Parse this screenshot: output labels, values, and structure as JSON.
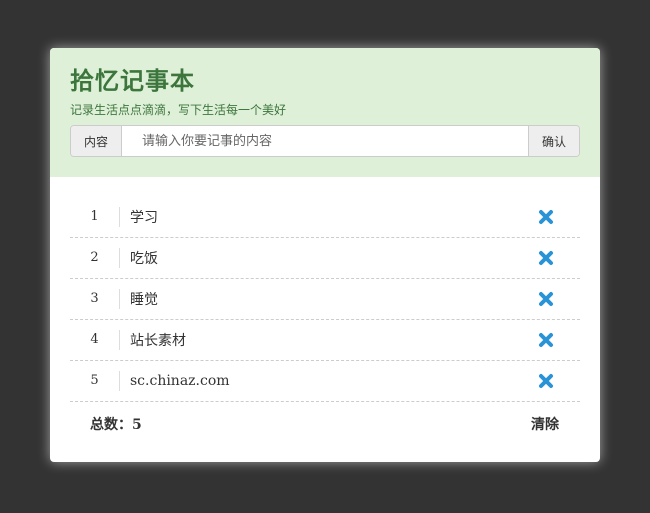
{
  "header": {
    "title": "拾忆记事本",
    "subtitle": "记录生活点点滴滴，写下生活每一个美好"
  },
  "input": {
    "addon_label": "内容",
    "placeholder": "请输入你要记事的内容",
    "value": "",
    "confirm_label": "确认"
  },
  "items": [
    {
      "num": "1",
      "text": "学习"
    },
    {
      "num": "2",
      "text": "吃饭"
    },
    {
      "num": "3",
      "text": "睡觉"
    },
    {
      "num": "4",
      "text": "站长素材"
    },
    {
      "num": "5",
      "text": "sc.chinaz.com"
    }
  ],
  "footer": {
    "total_label": "总数：5",
    "clear_label": "清除"
  },
  "icons": {
    "delete": "close-icon"
  },
  "colors": {
    "page_bg": "#333333",
    "header_bg": "#dff0d8",
    "title_green": "#3c763d",
    "delete_blue": "#2a93d5"
  }
}
